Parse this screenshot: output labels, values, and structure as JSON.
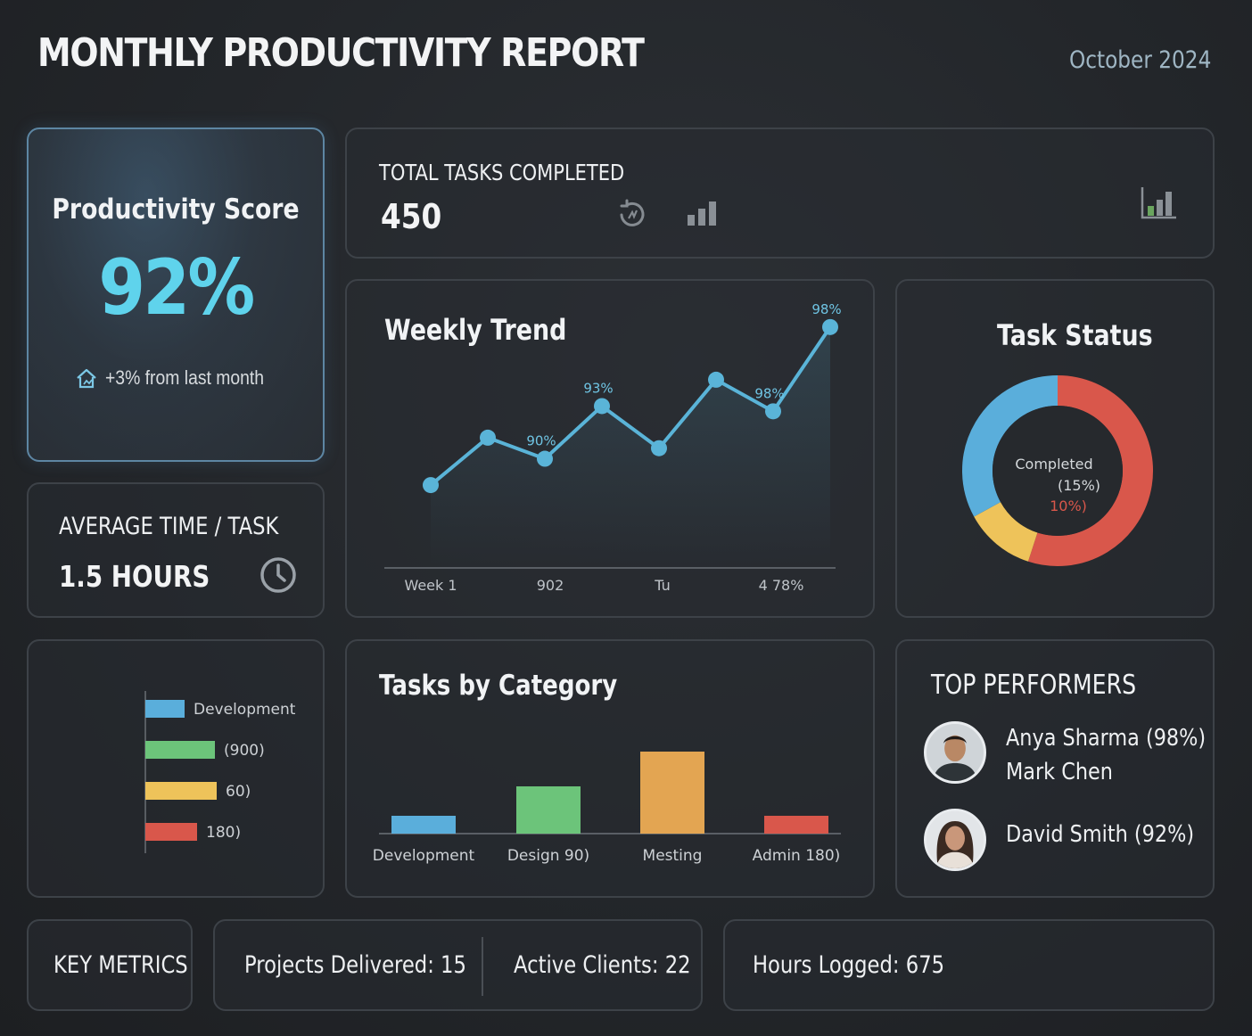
{
  "header": {
    "title": "MONTHLY PRODUCTIVITY REPORT",
    "date": "October 2024"
  },
  "productivity": {
    "label": "Productivity Score",
    "value": "92%",
    "change": "+3% from last month"
  },
  "average_time": {
    "label": "AVERAGE TIME / TASK",
    "value": "1.5 HOURS"
  },
  "total_tasks": {
    "label": "TOTAL TASKS COMPLETED",
    "value": "450"
  },
  "top_performers": {
    "title": "TOP PERFORMERS",
    "entries": [
      {
        "lines": [
          "Anya Sharma (98%)",
          "Mark Chen"
        ]
      },
      {
        "lines": [
          "David Smith (92%)"
        ]
      }
    ]
  },
  "key_metrics": {
    "label": "KEY METRICS",
    "projects": "Projects Delivered: 15",
    "clients": "Active Clients: 22",
    "hours": "Hours Logged: 675"
  },
  "colors": {
    "accent": "#5fd3ec",
    "line": "#5ab4d8",
    "blue": "#5aaedb",
    "green": "#6cc47a",
    "yellow": "#eec35a",
    "orange": "#e3a552",
    "red": "#d9574b"
  },
  "chart_data": [
    {
      "type": "line",
      "title": "Weekly Trend",
      "x_tick_labels": [
        "Week 1",
        "902",
        "Tu",
        "4 78%"
      ],
      "y": [
        84,
        88.5,
        86.5,
        91.5,
        87.5,
        94,
        91,
        99
      ],
      "point_labels": [
        {
          "index": 2,
          "text": "90%"
        },
        {
          "index": 3,
          "text": "93%"
        },
        {
          "index": 6,
          "text": "98%"
        },
        {
          "index": 7,
          "text": "98%"
        }
      ],
      "ylim": [
        78,
        100
      ],
      "grid": false
    },
    {
      "type": "pie",
      "title": "Task Status",
      "donut": true,
      "slices": [
        {
          "value": 55,
          "color": "#d9574b"
        },
        {
          "value": 12,
          "color": "#eec35a"
        },
        {
          "value": 33,
          "color": "#5aaedb"
        }
      ],
      "center_labels": [
        "Completed",
        "(15%)",
        "10%)"
      ]
    },
    {
      "type": "bar",
      "orientation": "horizontal",
      "labels": [
        "Development",
        "(900)",
        "60)",
        "180)"
      ],
      "values": [
        44,
        78,
        80,
        58
      ],
      "colors": [
        "#5aaedb",
        "#6cc47a",
        "#eec35a",
        "#d9574b"
      ]
    },
    {
      "type": "bar",
      "title": "Tasks by Category",
      "categories": [
        "Development",
        "Design 90)",
        "Mesting",
        "Admin 180)"
      ],
      "values": [
        20,
        53,
        92,
        20
      ],
      "colors": [
        "#5aaedb",
        "#6cc47a",
        "#e3a552",
        "#d9574b"
      ]
    }
  ]
}
